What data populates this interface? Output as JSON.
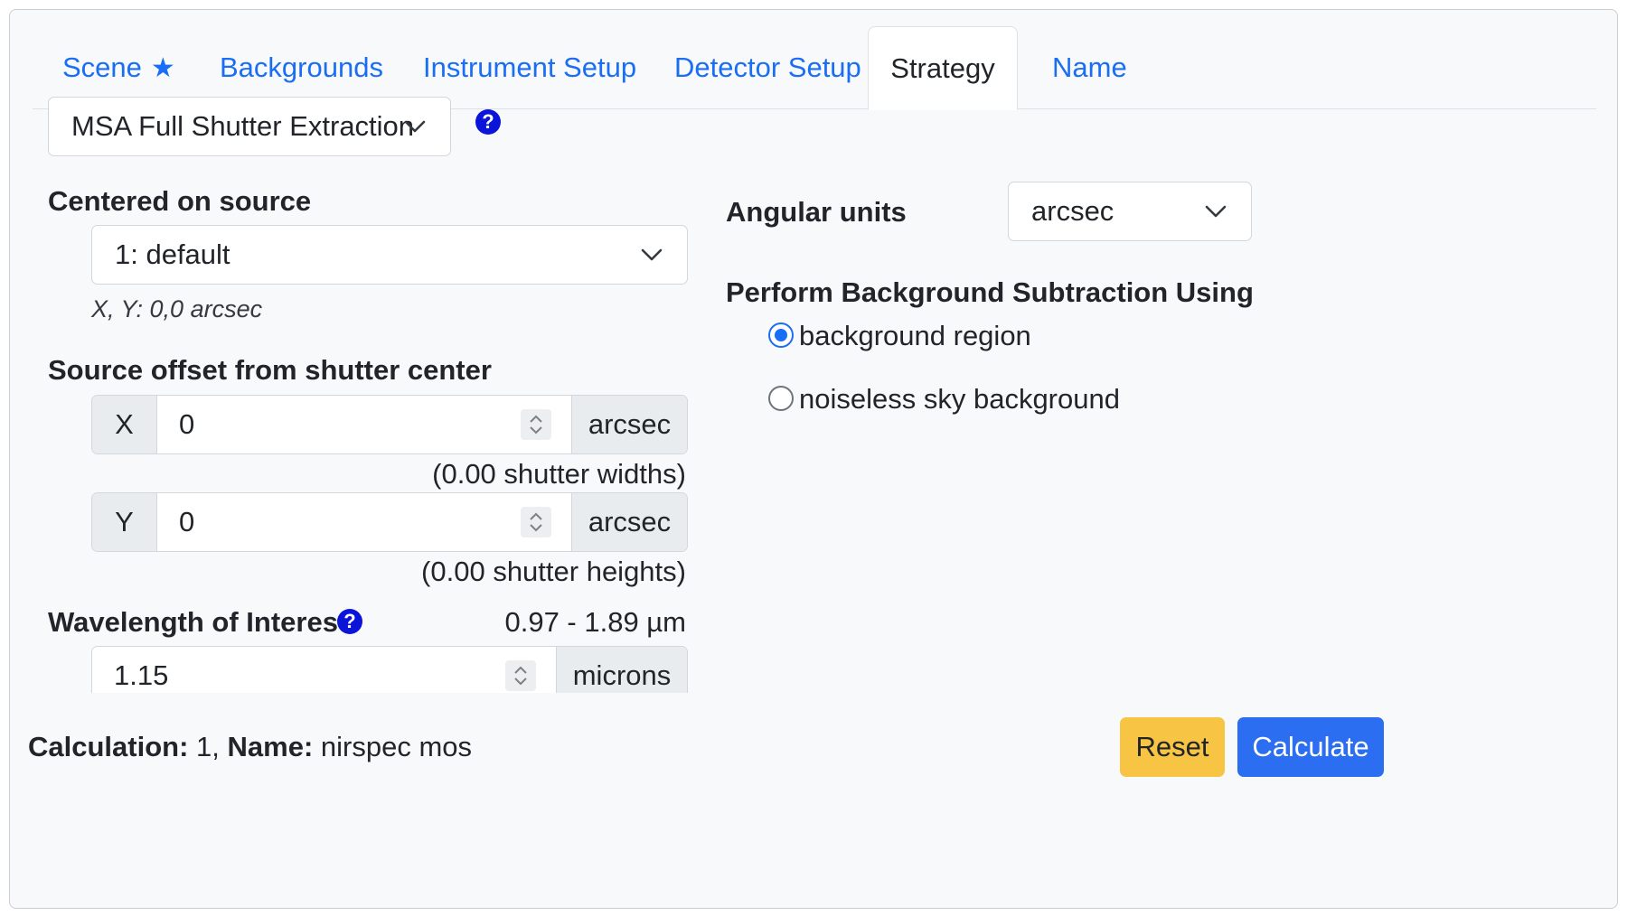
{
  "tabs": [
    {
      "label": "Scene",
      "star": "★"
    },
    {
      "label": "Backgrounds"
    },
    {
      "label": "Instrument Setup"
    },
    {
      "label": "Detector Setup"
    },
    {
      "label": "Strategy"
    },
    {
      "label": "Name"
    }
  ],
  "active_tab": "Strategy",
  "strategy_select": {
    "value": "MSA Full Shutter Extraction"
  },
  "help_glyph": "?",
  "centered": {
    "label": "Centered on source",
    "select_value": "1: default",
    "coords_note": "X, Y: 0,0 arcsec"
  },
  "offset": {
    "label": "Source offset from shutter center",
    "x": {
      "prefix": "X",
      "value": "0",
      "unit": "arcsec",
      "note": "(0.00 shutter widths)"
    },
    "y": {
      "prefix": "Y",
      "value": "0",
      "unit": "arcsec",
      "note": "(0.00 shutter heights)"
    }
  },
  "wavelength": {
    "label": "Wavelength of Interest",
    "range": "0.97 - 1.89 µm",
    "value": "1.15",
    "unit": "microns"
  },
  "angular_units": {
    "label": "Angular units",
    "value": "arcsec"
  },
  "background_subtraction": {
    "label": "Perform Background Subtraction Using",
    "options": [
      {
        "label": "background region",
        "checked": true
      },
      {
        "label": "noiseless sky background",
        "checked": false
      }
    ]
  },
  "footer": {
    "calc_label": "Calculation:",
    "calc_value": "1,",
    "name_label": "Name:",
    "name_value": "nirspec mos"
  },
  "buttons": {
    "reset": "Reset",
    "calculate": "Calculate"
  },
  "colors": {
    "link": "#1a6ef5",
    "help": "#0b14d9",
    "reset": "#f7c443",
    "calculate": "#2b6ef2"
  }
}
